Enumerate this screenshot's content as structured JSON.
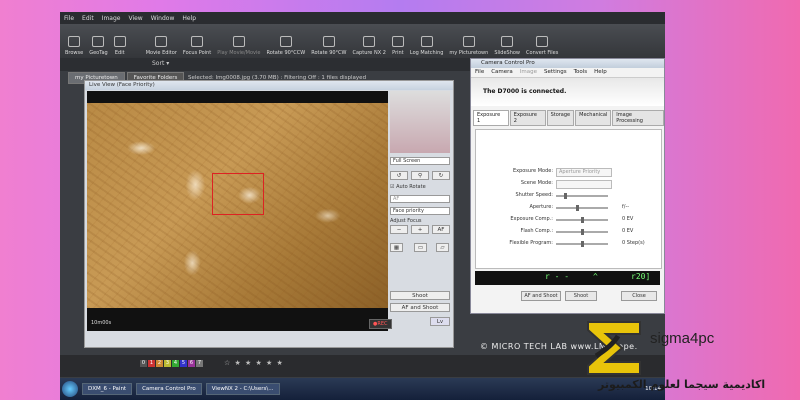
{
  "viewnx": {
    "menu": [
      "File",
      "Edit",
      "Image",
      "View",
      "Window",
      "Help"
    ],
    "toolbar": [
      {
        "label": "Browse",
        "disabled": false
      },
      {
        "label": "GeoTag",
        "disabled": false
      },
      {
        "label": "Edit",
        "disabled": false
      },
      {
        "label": "Movie Editor",
        "disabled": false
      },
      {
        "label": "Focus Point",
        "disabled": false
      },
      {
        "label": "Play Movie/Movie",
        "disabled": true
      },
      {
        "label": "Rotate 90°CCW",
        "disabled": false
      },
      {
        "label": "Rotate 90°CW",
        "disabled": false
      },
      {
        "label": "Capture NX 2",
        "disabled": false
      },
      {
        "label": "Print",
        "disabled": false
      },
      {
        "label": "Log Matching",
        "disabled": false
      },
      {
        "label": "my Picturetown",
        "disabled": false
      },
      {
        "label": "SlideShow",
        "disabled": false
      },
      {
        "label": "Convert Files",
        "disabled": false
      }
    ],
    "sort_label": "Sort ▾",
    "tabs": [
      "my Picturetown",
      "Favorite Folders"
    ],
    "selection_info": "Selected: Img0008.jpg (3.70 MB) : Filtering Off : 1 files displayed",
    "stars": "☆ ★ ★ ★ ★ ★"
  },
  "liveview": {
    "title": "Live View (Face Priority)",
    "timer": "10m00s",
    "rec": "●REC",
    "full_screen": "Full Screen",
    "auto_rotate": "Auto Rotate",
    "af_select": "AF",
    "face_priority": "Face priority",
    "adjust_focus": "Adjust Focus",
    "minus": "−",
    "plus": "+",
    "af": "AF",
    "shoot": "Shoot",
    "af_and_shoot": "AF and Shoot",
    "lv": "Lv"
  },
  "camera_control": {
    "title": "Camera Control Pro",
    "menu": [
      "File",
      "Camera",
      "Image",
      "Settings",
      "Tools",
      "Help"
    ],
    "connected": "The D7000 is connected.",
    "tabs": [
      "Exposure 1",
      "Exposure 2",
      "Storage",
      "Mechanical",
      "Image Processing"
    ],
    "rows": [
      {
        "label": "Exposure Mode:",
        "value": "Aperture Priority"
      },
      {
        "label": "Scene Mode:",
        "value": ""
      },
      {
        "label": "Shutter Speed:",
        "value": ""
      },
      {
        "label": "Aperture:",
        "value": "f/--"
      },
      {
        "label": "Exposure Comp.:",
        "value": "0 EV"
      },
      {
        "label": "Flash Comp.:",
        "value": "0 EV"
      },
      {
        "label": "Flexible Program:",
        "value": "0 Step(s)"
      }
    ],
    "lcd_left": "r - -",
    "lcd_mid": "^",
    "lcd_right": "r20]",
    "af_and_shoot": "AF and Shoot",
    "shoot": "Shoot",
    "close": "Close"
  },
  "watermark": "© MICRO TECH LAB  www.LMi...ope.",
  "taskbar": {
    "items": [
      "DXM_6 - Paint",
      "Camera Control Pro",
      "ViewNX 2 - C:\\Users\\..."
    ],
    "clock": "10:14"
  },
  "brand": {
    "name": "sigma4pc",
    "arabic": "اكاديمية سيجما لعلوم الكمبيوتر"
  }
}
